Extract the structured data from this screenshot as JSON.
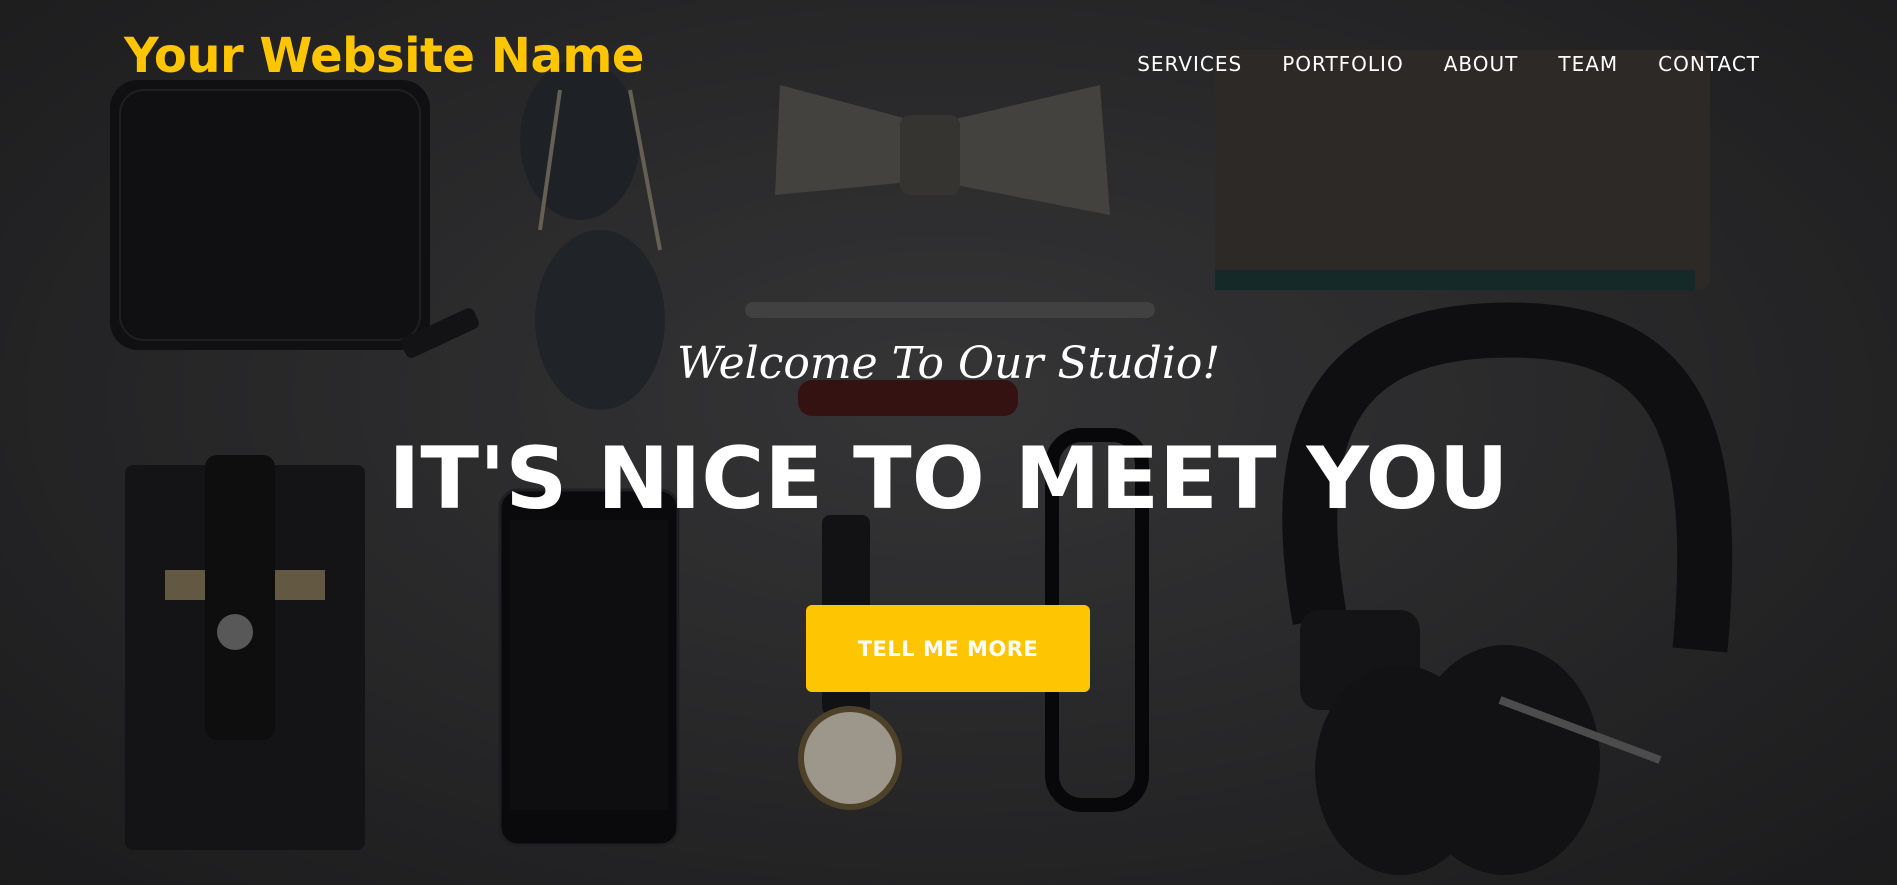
{
  "navbar": {
    "brand": "Your Website Name",
    "links": [
      "SERVICES",
      "PORTFOLIO",
      "ABOUT",
      "TEAM",
      "CONTACT"
    ]
  },
  "intro": {
    "lead": "Welcome To Our Studio!",
    "heading": "IT'S NICE TO MEET YOU",
    "button_label": "TELL ME MORE"
  },
  "colors": {
    "accent": "#fec503",
    "background": "#2e2e30",
    "text": "#ffffff"
  }
}
